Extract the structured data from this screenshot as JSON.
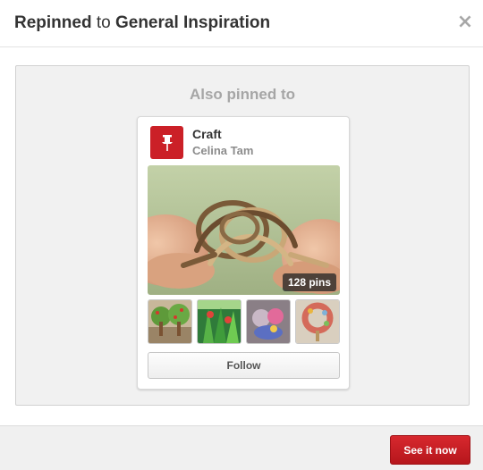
{
  "header": {
    "title_part1": "Repinned",
    "title_part2": " to ",
    "title_part3": "General Inspiration",
    "close_glyph": "×"
  },
  "section": {
    "heading": "Also pinned to"
  },
  "board": {
    "icon": "pushpin-icon",
    "name": "Craft",
    "owner": "Celina Tam",
    "pin_count": "128 pins",
    "follow_label": "Follow",
    "thumbnails": [
      "tree-craft",
      "leaf-window-art",
      "glass-mosaic",
      "button-wreath"
    ]
  },
  "footer": {
    "cta_label": "See it now"
  },
  "colors": {
    "brand_red": "#cb2027",
    "muted_text": "#a6a6a6",
    "panel_bg": "#f1f1f1"
  }
}
